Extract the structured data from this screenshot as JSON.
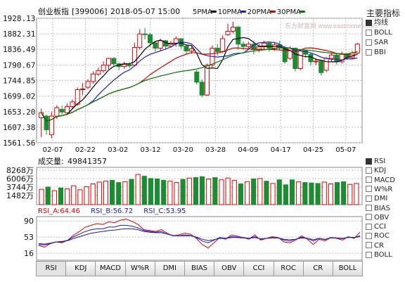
{
  "header": {
    "name": "创业板指",
    "code": "[399006]",
    "datetime": "2018-05-07 15:00",
    "ma_legend": [
      {
        "label": "5PMA",
        "color": "#000000"
      },
      {
        "label": "10PMA",
        "color": "#1c1cc8"
      },
      {
        "label": "20PMA",
        "color": "#cc0000"
      },
      {
        "label": "30PMA",
        "color": "#007700"
      }
    ]
  },
  "watermark": "东方财富网 www.eastmoney.com",
  "sidebar": {
    "title": "主要指标",
    "top_items": [
      {
        "label": "均线",
        "checked": true
      },
      {
        "label": "BOLL",
        "checked": false
      },
      {
        "label": "SAR",
        "checked": false
      },
      {
        "label": "BBI",
        "checked": false
      }
    ],
    "bottom_items": [
      {
        "label": "RSI",
        "checked": true
      },
      {
        "label": "KDJ",
        "checked": false
      },
      {
        "label": "MACD",
        "checked": false
      },
      {
        "label": "W%R",
        "checked": false
      },
      {
        "label": "DMI",
        "checked": false
      },
      {
        "label": "BIAS",
        "checked": false
      },
      {
        "label": "OBV",
        "checked": false
      },
      {
        "label": "CCI",
        "checked": false
      },
      {
        "label": "ROC",
        "checked": false
      },
      {
        "label": "CR",
        "checked": false
      },
      {
        "label": "BOLL",
        "checked": false
      }
    ]
  },
  "tabs": [
    "RSI",
    "KDJ",
    "MACD",
    "W%R",
    "DMI",
    "BIAS",
    "OBV",
    "CCI",
    "ROC",
    "CR",
    "BOLL"
  ],
  "active_tab": "RSI",
  "colors": {
    "up": "#e60000",
    "down": "#1e8a33",
    "grid": "#bfbfbf",
    "axis": "#888888"
  },
  "chart_data": [
    {
      "type": "candlestick",
      "title": "创业板指[399006] 2018-05-07 15:00",
      "y_ticks": [
        1928.13,
        1882.31,
        1836.49,
        1790.67,
        1744.85,
        1699.02,
        1653.2,
        1607.38,
        1561.56
      ],
      "ylim": [
        1561.56,
        1928.13
      ],
      "x_ticks": [
        "02-07",
        "02-22",
        "03-02",
        "03-12",
        "03-20",
        "03-28",
        "04-09",
        "04-17",
        "04-25",
        "05-07"
      ],
      "candles": [
        [
          1635,
          1650,
          1662,
          1578
        ],
        [
          1640,
          1600,
          1645,
          1585
        ],
        [
          1585,
          1640,
          1652,
          1575
        ],
        [
          1640,
          1665,
          1672,
          1632
        ],
        [
          1660,
          1652,
          1671,
          1645
        ],
        [
          1650,
          1668,
          1678,
          1646
        ],
        [
          1668,
          1682,
          1689,
          1661
        ],
        [
          1675,
          1718,
          1724,
          1670
        ],
        [
          1718,
          1720,
          1738,
          1702
        ],
        [
          1725,
          1742,
          1749,
          1719
        ],
        [
          1742,
          1764,
          1772,
          1735
        ],
        [
          1764,
          1774,
          1783,
          1758
        ],
        [
          1774,
          1790,
          1801,
          1768
        ],
        [
          1790,
          1810,
          1812,
          1779
        ],
        [
          1810,
          1794,
          1813,
          1788
        ],
        [
          1794,
          1786,
          1797,
          1776
        ],
        [
          1786,
          1792,
          1800,
          1780
        ],
        [
          1792,
          1788,
          1798,
          1782
        ],
        [
          1790,
          1842,
          1856,
          1786
        ],
        [
          1842,
          1882,
          1896,
          1836
        ],
        [
          1882,
          1880,
          1900,
          1866
        ],
        [
          1880,
          1856,
          1885,
          1845
        ],
        [
          1856,
          1840,
          1862,
          1830
        ],
        [
          1840,
          1862,
          1868,
          1831
        ],
        [
          1862,
          1846,
          1864,
          1836
        ],
        [
          1846,
          1855,
          1861,
          1840
        ],
        [
          1855,
          1868,
          1875,
          1845
        ],
        [
          1868,
          1846,
          1869,
          1838
        ],
        [
          1846,
          1832,
          1850,
          1822
        ],
        [
          1832,
          1838,
          1845,
          1824
        ],
        [
          1770,
          1740,
          1776,
          1733
        ],
        [
          1740,
          1702,
          1748,
          1695
        ],
        [
          1702,
          1790,
          1795,
          1699
        ],
        [
          1790,
          1840,
          1848,
          1784
        ],
        [
          1840,
          1830,
          1852,
          1818
        ],
        [
          1830,
          1868,
          1878,
          1826
        ],
        [
          1880,
          1890,
          1912,
          1876
        ],
        [
          1890,
          1902,
          1918,
          1884
        ],
        [
          1902,
          1852,
          1906,
          1836
        ],
        [
          1852,
          1845,
          1860,
          1836
        ],
        [
          1845,
          1852,
          1858,
          1838
        ],
        [
          1852,
          1836,
          1862,
          1822
        ],
        [
          1836,
          1844,
          1852,
          1828
        ],
        [
          1844,
          1855,
          1862,
          1838
        ],
        [
          1855,
          1840,
          1860,
          1830
        ],
        [
          1840,
          1850,
          1858,
          1832
        ],
        [
          1850,
          1842,
          1862,
          1834
        ],
        [
          1842,
          1800,
          1848,
          1795
        ],
        [
          1810,
          1840,
          1845,
          1806
        ],
        [
          1840,
          1780,
          1842,
          1772
        ],
        [
          1780,
          1832,
          1838,
          1775
        ],
        [
          1832,
          1822,
          1836,
          1812
        ],
        [
          1822,
          1800,
          1828,
          1790
        ],
        [
          1800,
          1802,
          1810,
          1790
        ],
        [
          1802,
          1768,
          1806,
          1760
        ],
        [
          1775,
          1810,
          1815,
          1770
        ],
        [
          1810,
          1820,
          1828,
          1801
        ],
        [
          1820,
          1800,
          1826,
          1792
        ],
        [
          1800,
          1822,
          1830,
          1795
        ],
        [
          1822,
          1812,
          1826,
          1805
        ],
        [
          1812,
          1826,
          1832,
          1808
        ],
        [
          1826,
          1852,
          1856,
          1822
        ]
      ],
      "ma_series": [
        {
          "name": "5PMA",
          "color": "#000000"
        },
        {
          "name": "10PMA",
          "color": "#1c1cc8"
        },
        {
          "name": "20PMA",
          "color": "#cc0000"
        },
        {
          "name": "30PMA",
          "color": "#007700"
        }
      ]
    },
    {
      "type": "bar",
      "title_label": "成交量:",
      "title_value": "49841357",
      "y_ticks": [
        "8268万",
        "6006万",
        "3744万",
        "1482万"
      ],
      "volumes": [
        3400,
        3900,
        3100,
        3700,
        3500,
        4200,
        3300,
        4000,
        4600,
        5000,
        5200,
        5400,
        4900,
        5100,
        5600,
        6700,
        6300,
        5800,
        5700,
        5400,
        5200,
        4900,
        5600,
        5900,
        6000,
        6200,
        5700,
        6000,
        5500,
        5900,
        5400,
        4600,
        5100,
        5700,
        5800,
        5200,
        4700,
        5500,
        4400,
        5500,
        5100,
        4900,
        4800,
        4700,
        5000,
        4600,
        4900,
        5100,
        4500,
        4700
      ]
    },
    {
      "type": "line",
      "title": "RSI",
      "y_ticks": [
        90,
        53,
        16
      ],
      "ylim": [
        0,
        100
      ],
      "series": [
        {
          "name": "RSI_A",
          "label": "RSI_A:64.46",
          "color": "#e60000",
          "values": [
            34,
            30,
            38,
            42,
            40,
            46,
            58,
            66,
            76,
            80,
            84,
            82,
            88,
            86,
            92,
            94,
            89,
            82,
            70,
            68,
            66,
            70,
            62,
            56,
            58,
            62,
            60,
            50,
            36,
            28,
            40,
            52,
            48,
            58,
            55,
            52,
            48,
            58,
            46,
            50,
            54,
            52,
            42,
            40,
            46,
            56,
            48,
            36,
            48,
            44,
            52,
            50,
            46,
            54,
            50,
            64
          ]
        },
        {
          "name": "RSI_B",
          "label": "RSI_B:56.72",
          "color": "#1c1cc8",
          "values": [
            36,
            35,
            38,
            42,
            42,
            46,
            54,
            60,
            66,
            70,
            72,
            72,
            76,
            76,
            80,
            80,
            78,
            74,
            68,
            66,
            64,
            66,
            60,
            56,
            56,
            58,
            57,
            52,
            44,
            40,
            46,
            52,
            50,
            54,
            53,
            52,
            50,
            54,
            48,
            50,
            52,
            51,
            46,
            44,
            48,
            53,
            50,
            44,
            50,
            47,
            52,
            51,
            49,
            53,
            52,
            56
          ]
        },
        {
          "name": "RSI_C",
          "label": "RSI_C:53.95",
          "color": "#1c1c9c",
          "values": [
            38,
            37,
            39,
            42,
            43,
            45,
            50,
            54,
            58,
            62,
            64,
            66,
            68,
            69,
            71,
            72,
            72,
            70,
            66,
            64,
            63,
            63,
            60,
            57,
            56,
            56,
            56,
            53,
            48,
            45,
            47,
            50,
            50,
            52,
            52,
            51,
            50,
            52,
            49,
            50,
            51,
            51,
            48,
            47,
            48,
            51,
            50,
            47,
            50,
            48,
            51,
            51,
            50,
            52,
            52,
            54
          ]
        }
      ]
    }
  ]
}
